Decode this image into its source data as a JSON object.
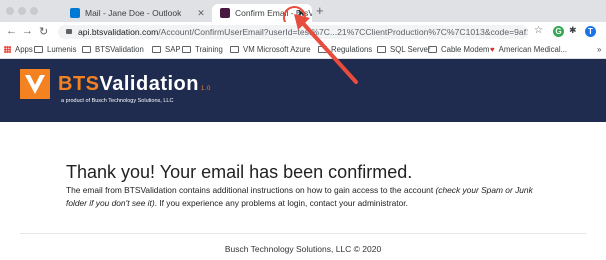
{
  "browser": {
    "tabs": [
      {
        "title": "Mail - Jane Doe - Outlook",
        "favicon_color": "#0078d4"
      },
      {
        "title": "Confirm Email - BtsValidation",
        "favicon_color": "#4a1942",
        "active": true
      }
    ],
    "new_tab_symbol": "+",
    "close_symbol": "✕",
    "url_host": "api.btsvalidation.com",
    "url_path": "/Account/ConfirmUserEmail?userId=test%7C...21%7CClientProduction%7C%7C1013&code=9af1d1...",
    "bookmarks": [
      "Apps",
      "Lumenis",
      "BTSValidation",
      "SAP",
      "Training",
      "VM Microsoft Azure",
      "Regulations",
      "SQL Server",
      "Cable Modem",
      "American Medical..."
    ],
    "overflow_symbol": "»"
  },
  "header": {
    "brand_prefix": "BTS",
    "brand_suffix": "Validation",
    "version": "1.0",
    "tagline": "a product of Busch Technology Solutions, LLC"
  },
  "content": {
    "heading": "Thank you! Your email has been confirmed.",
    "message_start": "The email from BTSValidation contains additional instructions on how to gain access to the account ",
    "message_italic": "(check your Spam or Junk folder if you don't see it)",
    "message_end": ". If you experience any problems at login, contact your administrator."
  },
  "footer": {
    "text": "Busch Technology Solutions, LLC © 2020"
  },
  "colors": {
    "banner": "#1f2c4f",
    "accent": "#f58220",
    "annotation": "#e74c3c"
  }
}
